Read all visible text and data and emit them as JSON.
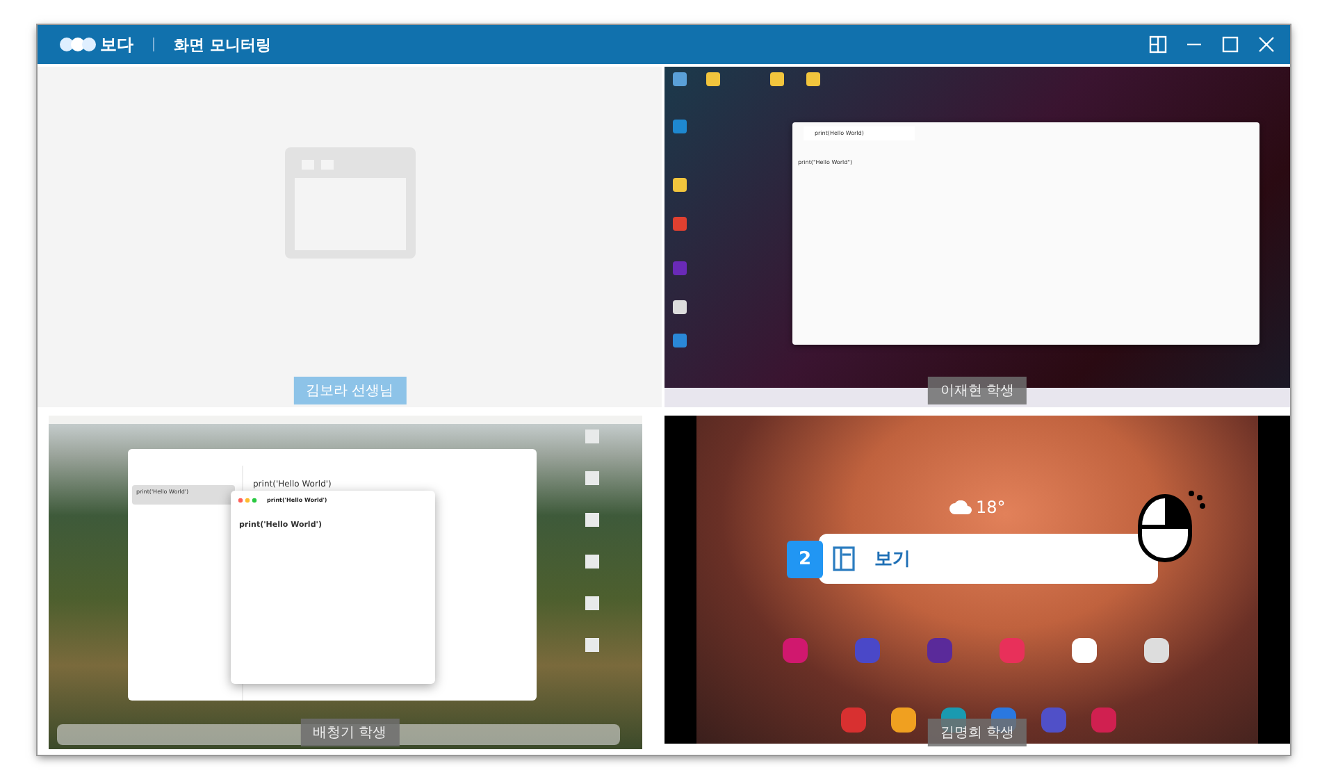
{
  "window": {
    "logo_text": "보다",
    "title": "화면 모니터링"
  },
  "screens": [
    {
      "kind": "empty",
      "label": "김보라 선생님"
    },
    {
      "kind": "windows",
      "label": "이재현 학생",
      "editor": {
        "title": "print(Hello World)",
        "content": "print(\"Hello World\")"
      }
    },
    {
      "kind": "mac",
      "label": "배청기 학생",
      "notes": {
        "list_item": "print('Hello World')",
        "heading": "print('Hello World')",
        "popup_title": "print('Hello World')",
        "content": "print('Hello World')"
      }
    },
    {
      "kind": "tablet",
      "label": "김명희 학생",
      "weather": "18°",
      "popup": {
        "badge": "2",
        "label": "보기"
      }
    }
  ]
}
